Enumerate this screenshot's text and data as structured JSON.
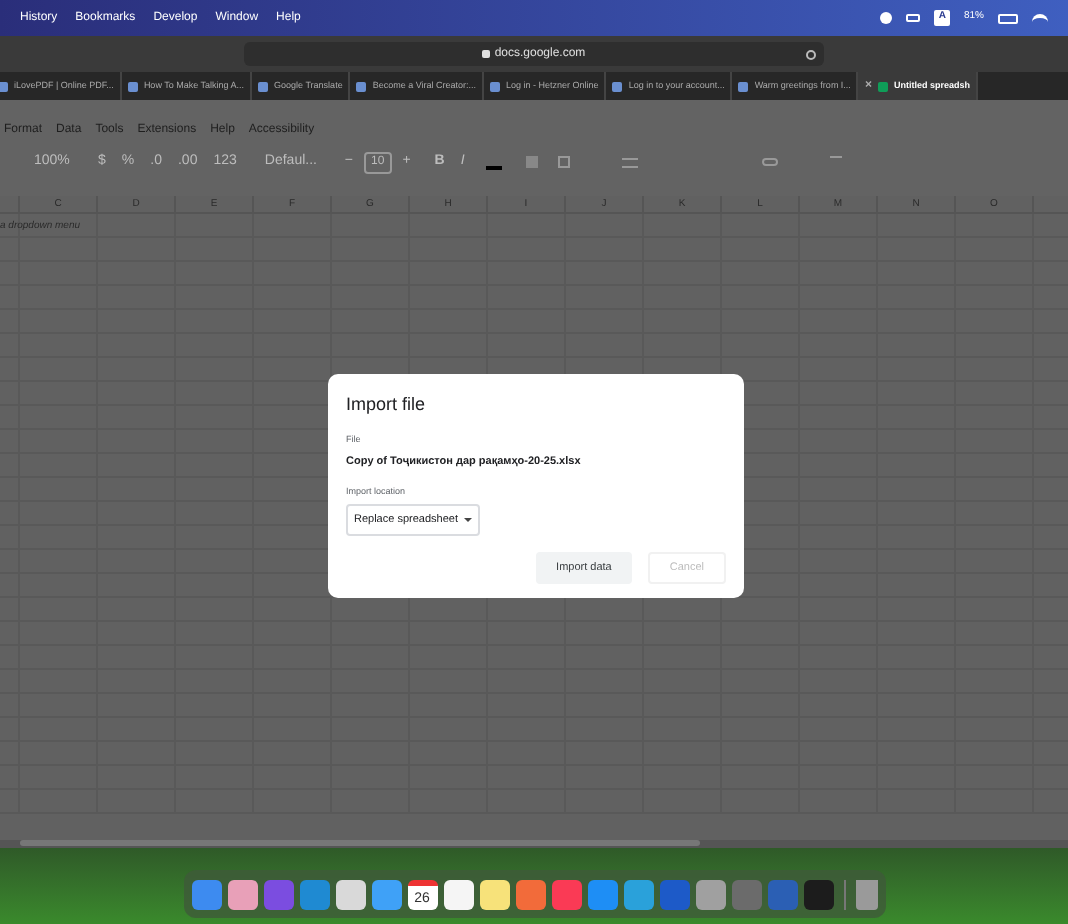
{
  "menu_bar": {
    "items": [
      "History",
      "Bookmarks",
      "Develop",
      "Window",
      "Help"
    ],
    "input_source": "A",
    "battery": "81%"
  },
  "address_bar": {
    "url": "docs.google.com"
  },
  "tabs": [
    {
      "label": "iLovePDF | Online PDF...",
      "selected": false
    },
    {
      "label": "How To Make Talking A...",
      "selected": false
    },
    {
      "label": "Google Translate",
      "selected": false
    },
    {
      "label": "Become a Viral Creator:...",
      "selected": false
    },
    {
      "label": "Log in - Hetzner Online",
      "selected": false
    },
    {
      "label": "Log in to your account...",
      "selected": false
    },
    {
      "label": "Warm greetings from I...",
      "selected": false
    },
    {
      "label": "Untitled spreadsh",
      "selected": true
    }
  ],
  "tab_close": "×",
  "sheets_menu": [
    "Format",
    "Data",
    "Tools",
    "Extensions",
    "Help",
    "Accessibility"
  ],
  "toolbar": {
    "zoom": "100%",
    "currency": "$",
    "percent": "%",
    "decrease_decimals": ".0",
    "increase_decimals": ".00",
    "number_format": "123",
    "font": "Defaul...",
    "minus": "−",
    "font_size": "10",
    "plus": "+",
    "bold": "B",
    "italic": "I"
  },
  "columns": [
    "C",
    "D",
    "E",
    "F",
    "G",
    "H",
    "I",
    "J",
    "K",
    "L",
    "M",
    "N",
    "O"
  ],
  "cell_text": "a dropdown menu",
  "dialog": {
    "title": "Import file",
    "file_label": "File",
    "file_name": "Copy of Тоҷикистон дар рақамҳо-20-25.xlsx",
    "location_label": "Import location",
    "location_value": "Replace spreadsheet",
    "buttons": [
      {
        "label": "Import data",
        "disabled": false
      },
      {
        "label": "Cancel",
        "disabled": true
      }
    ]
  },
  "dock": {
    "calendar_date": "26"
  }
}
